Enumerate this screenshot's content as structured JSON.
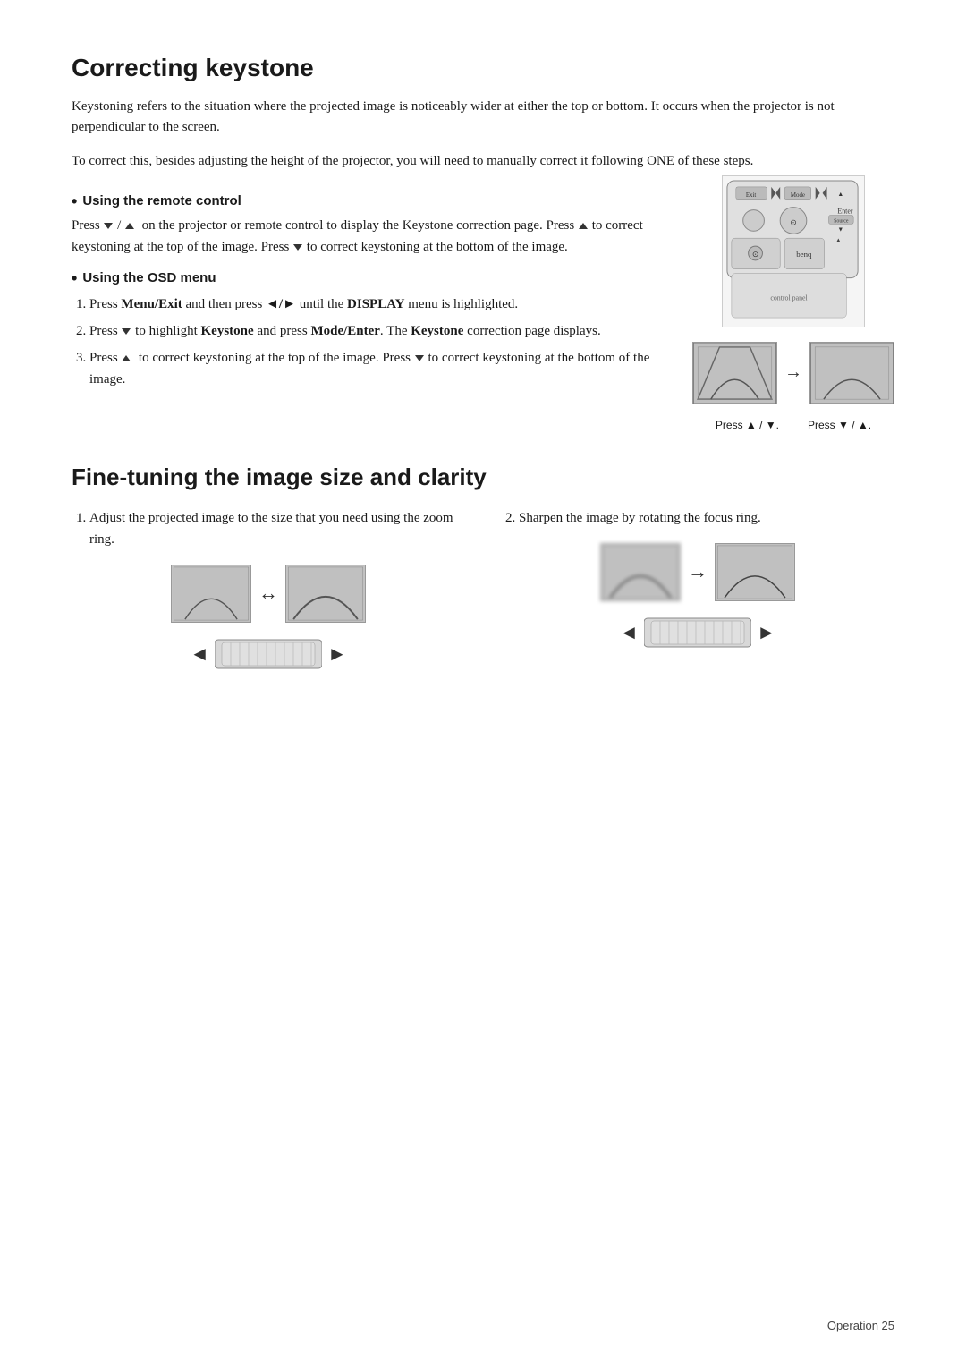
{
  "page": {
    "title": "Correcting keystone",
    "title2": "Fine-tuning the image size and clarity",
    "footer": "Operation    25"
  },
  "correcting_keystone": {
    "intro1": "Keystoning refers to the situation where the projected image is noticeably wider at either the top or bottom. It occurs when the projector is not perpendicular to the screen.",
    "intro2": "To correct this, besides adjusting the height of the projector, you will need to manually correct it following ONE of these steps.",
    "using_remote": {
      "heading": "Using the remote control",
      "body1": "Press ▼ / ▲  on the projector or remote control to display the Keystone correction page. Press ▲ to correct keystoning at the top of the image. Press ▼ to correct keystoning at the bottom of the image."
    },
    "using_osd": {
      "heading": "Using the OSD menu",
      "steps": [
        "Press Menu/Exit and then press ◄/► until the DISPLAY menu is highlighted.",
        "Press ▼ to highlight Keystone and press Mode/Enter. The Keystone correction page displays.",
        "Press ▲  to correct keystoning at the top of the image. Press ▼ to correct keystoning at the bottom of the image."
      ]
    },
    "press_labels": {
      "left": "Press ▲ / ▼.",
      "right": "Press ▼ / ▲."
    }
  },
  "fine_tuning": {
    "col1": {
      "step": "1.",
      "text": "Adjust the projected image to the size that you need using the zoom ring."
    },
    "col2": {
      "step": "2.",
      "text": "Sharpen the image by rotating the focus ring."
    }
  },
  "icons": {
    "bullet": "•",
    "arrow_right": "→",
    "arrow_left_right": "↔",
    "arrow_both": "◄————►"
  }
}
